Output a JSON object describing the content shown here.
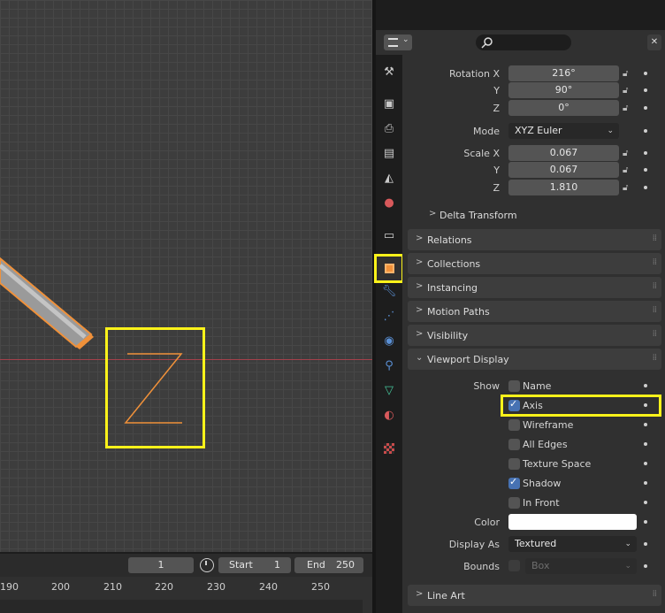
{
  "viewport": {
    "object_label": "Z"
  },
  "timeline": {
    "current_frame": "1",
    "start_label": "Start",
    "start_value": "1",
    "end_label": "End",
    "end_value": "250",
    "ticks": [
      "190",
      "200",
      "210",
      "220",
      "230",
      "240",
      "250"
    ]
  },
  "properties": {
    "search_placeholder": "",
    "rotation": {
      "x_label": "Rotation X",
      "x": "216°",
      "y_label": "Y",
      "y": "90°",
      "z_label": "Z",
      "z": "0°"
    },
    "mode": {
      "label": "Mode",
      "value": "XYZ Euler"
    },
    "scale": {
      "x_label": "Scale X",
      "x": "0.067",
      "y_label": "Y",
      "y": "0.067",
      "z_label": "Z",
      "z": "1.810"
    },
    "delta_transform": "Delta Transform",
    "panels": {
      "relations": "Relations",
      "collections": "Collections",
      "instancing": "Instancing",
      "motion_paths": "Motion Paths",
      "visibility": "Visibility",
      "viewport_display": "Viewport Display",
      "line_art": "Line Art"
    },
    "viewport_display": {
      "show_label": "Show",
      "name": "Name",
      "axis": "Axis",
      "wireframe": "Wireframe",
      "all_edges": "All Edges",
      "texture_space": "Texture Space",
      "shadow": "Shadow",
      "in_front": "In Front",
      "color_label": "Color",
      "color_value": "#ffffff",
      "display_as_label": "Display As",
      "display_as_value": "Textured",
      "bounds_label": "Bounds",
      "bounds_value": "Box"
    }
  },
  "colors": {
    "highlight": "#fbf21a",
    "selection_orange": "#f0913a",
    "checkbox_blue": "#4772b3",
    "x_axis_red": "#a4404b"
  },
  "icons": [
    "tool-icon",
    "render-icon",
    "output-icon",
    "view-layer-icon",
    "scene-icon",
    "world-icon",
    "collection-icon",
    "object-icon",
    "modifier-icon",
    "particles-icon",
    "physics-icon",
    "constraints-icon",
    "data-icon",
    "material-icon",
    "texture-icon"
  ]
}
